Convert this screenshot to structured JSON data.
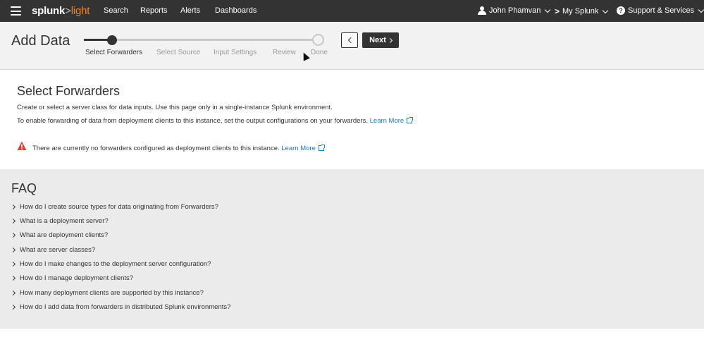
{
  "nav": {
    "logo_splunk": "splunk",
    "logo_gt": ">",
    "logo_light": "light",
    "items": [
      "Search",
      "Reports",
      "Alerts",
      "Dashboards"
    ],
    "user": "John Phamvan",
    "my_splunk": "My Splunk",
    "support": "Support & Services"
  },
  "wizard": {
    "title": "Add Data",
    "steps": [
      "Select Forwarders",
      "Select Source",
      "Input Settings",
      "Review",
      "Done"
    ],
    "next_label": "Next"
  },
  "main": {
    "title": "Select Forwarders",
    "line1": "Create or select a server class for data inputs. Use this page only in a single-instance Splunk environment.",
    "line2": "To enable forwarding of data from deployment clients to this instance, set the output configurations on your forwarders.",
    "learn_more": "Learn More",
    "warning": "There are currently no forwarders configured as deployment clients to this instance."
  },
  "faq": {
    "title": "FAQ",
    "items": [
      "How do I create source types for data originating from Forwarders?",
      "What is a deployment server?",
      "What are deployment clients?",
      "What are server classes?",
      "How do I make changes to the deployment server configuration?",
      "How do I manage deployment clients?",
      "How many deployment clients are supported by this instance?",
      "How do I add data from forwarders in distributed Splunk environments?"
    ]
  },
  "colors": {
    "topbar": "#333333",
    "accent": "#f58220",
    "link": "#1a7abf",
    "warning": "#d6433a"
  }
}
